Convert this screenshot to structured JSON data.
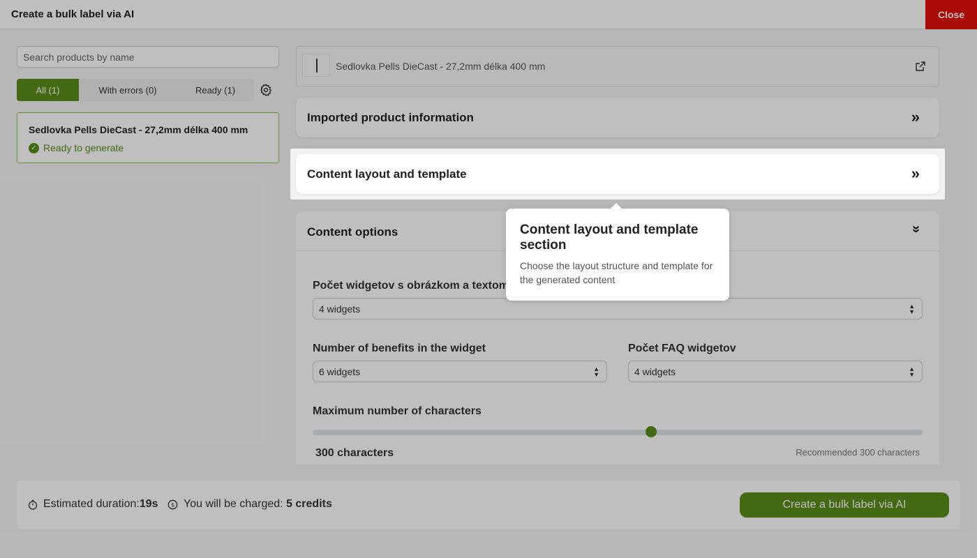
{
  "header": {
    "title": "Create a bulk label via AI",
    "close_label": "Close"
  },
  "search": {
    "placeholder": "Search products by name"
  },
  "filters": {
    "all": "All (1)",
    "errors": "With errors (0)",
    "ready": "Ready (1)"
  },
  "product": {
    "name": "Sedlovka Pells DieCast - 27,2mm délka 400 mm",
    "status": "Ready to generate"
  },
  "detail": {
    "product_title": "Sedlovka Pells DieCast - 27,2mm délka 400 mm",
    "sections": {
      "imported": "Imported product information",
      "layout": "Content layout and template",
      "options": "Content options"
    },
    "fields": {
      "image_text_label": "Počet widgetov s obrázkom a textom",
      "image_text_value": "4 widgets",
      "benefits_label": "Number of benefits in the widget",
      "benefits_value": "6 widgets",
      "faq_label": "Počet FAQ widgetov",
      "faq_value": "4 widgets",
      "max_chars_label": "Maximum number of characters",
      "max_chars_value": "300 characters",
      "max_chars_recommended": "Recommended 300 characters"
    },
    "slider": {
      "fraction": 0.555
    }
  },
  "tooltip": {
    "title": "Content layout and template section",
    "text": "Choose the layout structure and template for the generated content"
  },
  "footer": {
    "duration_label": "Estimated duration:",
    "duration_value": "19s",
    "charge_label": "You will be charged: ",
    "charge_value": "5 credits",
    "create_label": "Create a bulk label via AI"
  },
  "colors": {
    "accent": "#5a8c1a",
    "close": "#e3120b"
  }
}
